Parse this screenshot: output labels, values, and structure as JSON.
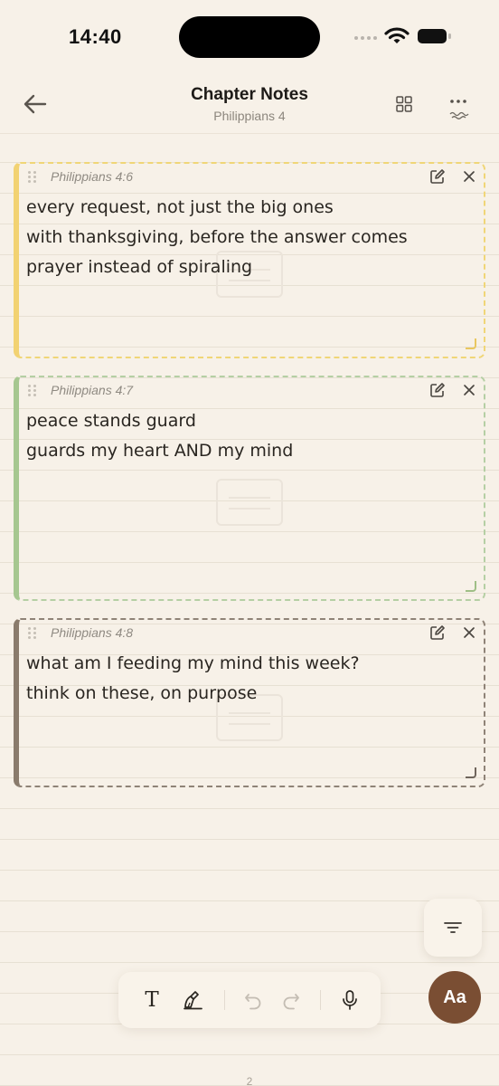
{
  "status_bar": {
    "time": "14:40"
  },
  "header": {
    "title": "Chapter Notes",
    "subtitle": "Philippians 4"
  },
  "notes": [
    {
      "reference": "Philippians 4:6",
      "color": "#f2d272",
      "lines": [
        "every request, not just the big ones",
        "with thanksgiving, before the answer comes",
        "prayer instead of spiraling"
      ]
    },
    {
      "reference": "Philippians 4:7",
      "color": "#a6c790",
      "lines": [
        "peace stands guard",
        "guards my heart AND my mind"
      ]
    },
    {
      "reference": "Philippians 4:8",
      "color": "#8a7b6c",
      "lines": [
        "what am I feeding my mind this week?",
        "think on these, on purpose"
      ]
    }
  ],
  "toolbar": {
    "text_tool": "T"
  },
  "fab": {
    "label": "Aa",
    "color": "#7a4e33"
  },
  "page_indicator": "2",
  "colors": {
    "background": "#f7f1e8",
    "accent": "#7a4e33"
  }
}
